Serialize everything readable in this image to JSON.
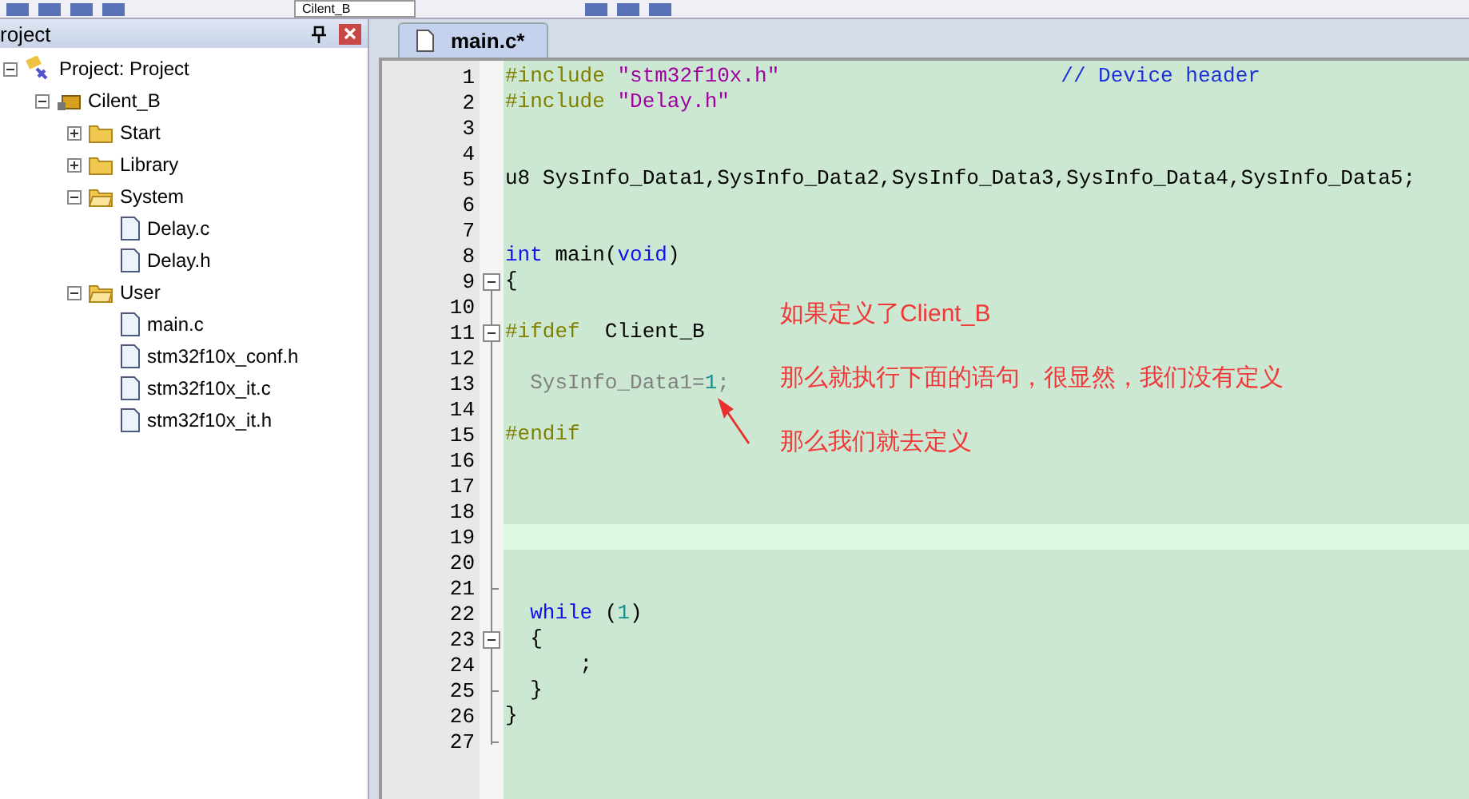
{
  "toolbar": {
    "target": "Cilent_B"
  },
  "project_panel": {
    "title": "roject",
    "tree": [
      {
        "label": "Project: Project",
        "kind": "project",
        "expanded": true,
        "children": [
          {
            "label": "Cilent_B",
            "kind": "target",
            "expanded": true,
            "children": [
              {
                "label": "Start",
                "kind": "folder",
                "expanded": false
              },
              {
                "label": "Library",
                "kind": "folder",
                "expanded": false
              },
              {
                "label": "System",
                "kind": "folder",
                "expanded": true,
                "children": [
                  {
                    "label": "Delay.c",
                    "kind": "file"
                  },
                  {
                    "label": "Delay.h",
                    "kind": "file"
                  }
                ]
              },
              {
                "label": "User",
                "kind": "folder",
                "expanded": true,
                "children": [
                  {
                    "label": "main.c",
                    "kind": "file"
                  },
                  {
                    "label": "stm32f10x_conf.h",
                    "kind": "file"
                  },
                  {
                    "label": "stm32f10x_it.c",
                    "kind": "file"
                  },
                  {
                    "label": "stm32f10x_it.h",
                    "kind": "file"
                  }
                ]
              }
            ]
          }
        ]
      }
    ]
  },
  "tabs": [
    {
      "label": "main.c*",
      "selected": true
    }
  ],
  "editor": {
    "lines": [
      {
        "no": "1",
        "kind": "code",
        "current": false,
        "tokens": [
          {
            "text": "#include ",
            "kind": "pre"
          },
          {
            "text": "\"stm32f10x.h\"",
            "kind": "str"
          },
          {
            "text": "// Device header",
            "kind": "comment"
          }
        ]
      },
      {
        "no": "2",
        "kind": "code",
        "current": false,
        "tokens": [
          {
            "text": "#include ",
            "kind": "pre"
          },
          {
            "text": "\"Delay.h\"",
            "kind": "str"
          }
        ]
      },
      {
        "no": "3",
        "kind": "code",
        "current": false
      },
      {
        "no": "4",
        "kind": "code",
        "current": false
      },
      {
        "no": "5",
        "kind": "code",
        "current": false,
        "tokens": [
          {
            "text": "u8 SysInfo_Data1,SysInfo_Data2,SysInfo_Data3,SysInfo_Data4,SysInfo_Data5;",
            "kind": "plain"
          }
        ]
      },
      {
        "no": "6",
        "kind": "code",
        "current": false
      },
      {
        "no": "7",
        "kind": "code",
        "current": false
      },
      {
        "no": "8",
        "kind": "code",
        "current": false,
        "tokens": [
          {
            "text": "int",
            "kind": "kw"
          },
          {
            "text": " main(",
            "kind": "plain"
          },
          {
            "text": "void",
            "kind": "kw"
          },
          {
            "text": ")",
            "kind": "plain"
          }
        ]
      },
      {
        "no": "9",
        "kind": "fold_start",
        "current": false,
        "tokens": [
          {
            "text": "{",
            "kind": "plain"
          }
        ]
      },
      {
        "no": "10",
        "kind": "code",
        "current": false
      },
      {
        "no": "11",
        "kind": "fold_start",
        "current": false,
        "tokens": [
          {
            "text": "#ifdef",
            "kind": "pre"
          },
          {
            "text": "  Client_B",
            "kind": "plain"
          }
        ]
      },
      {
        "no": "12",
        "kind": "code",
        "current": false
      },
      {
        "no": "13",
        "kind": "code",
        "current": false,
        "tokens": [
          {
            "text": "  SysInfo_Data1=",
            "kind": "inactive"
          },
          {
            "text": "1",
            "kind": "num"
          },
          {
            "text": ";",
            "kind": "inactive"
          }
        ]
      },
      {
        "no": "14",
        "kind": "code",
        "current": false
      },
      {
        "no": "15",
        "kind": "code",
        "current": false,
        "tokens": [
          {
            "text": "#endif",
            "kind": "pre"
          }
        ]
      },
      {
        "no": "16",
        "kind": "code",
        "current": false
      },
      {
        "no": "17",
        "kind": "code",
        "current": false
      },
      {
        "no": "18",
        "kind": "code",
        "current": false
      },
      {
        "no": "19",
        "kind": "code",
        "current": true
      },
      {
        "no": "20",
        "kind": "code",
        "current": false
      },
      {
        "no": "21",
        "kind": "fold_end",
        "current": false
      },
      {
        "no": "22",
        "kind": "code",
        "current": false,
        "tokens": [
          {
            "text": "  while",
            "kind": "kw"
          },
          {
            "text": " (",
            "kind": "plain"
          },
          {
            "text": "1",
            "kind": "num"
          },
          {
            "text": ")",
            "kind": "plain"
          }
        ]
      },
      {
        "no": "23",
        "kind": "fold_start",
        "current": false,
        "tokens": [
          {
            "text": "  {",
            "kind": "plain"
          }
        ]
      },
      {
        "no": "24",
        "kind": "code",
        "current": false,
        "tokens": [
          {
            "text": "      ;",
            "kind": "plain"
          }
        ]
      },
      {
        "no": "25",
        "kind": "fold_end",
        "current": false,
        "tokens": [
          {
            "text": "  }",
            "kind": "plain"
          }
        ]
      },
      {
        "no": "26",
        "kind": "code",
        "current": false,
        "tokens": [
          {
            "text": "}",
            "kind": "plain"
          }
        ]
      },
      {
        "no": "27",
        "kind": "fold_end",
        "current": false
      }
    ]
  },
  "annotations": [
    "如果定义了Client_B",
    "那么就执行下面的语句，很显然，我们没有定义",
    "那么我们就去定义"
  ]
}
